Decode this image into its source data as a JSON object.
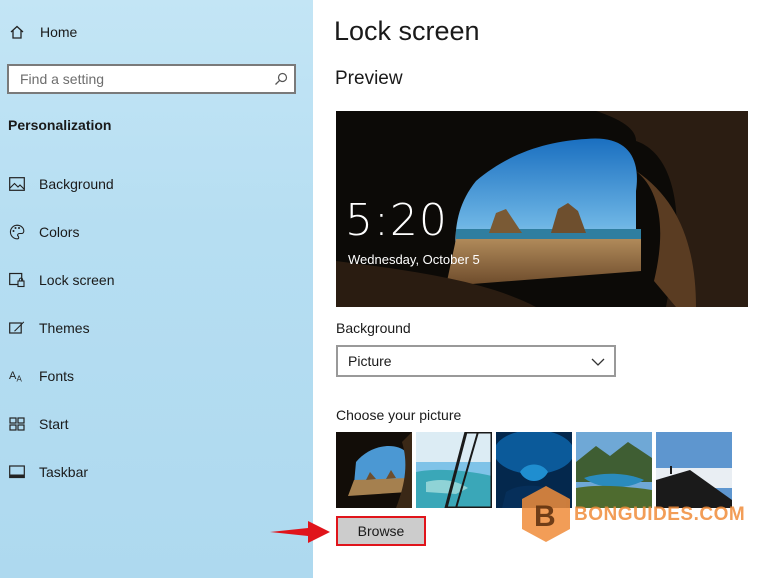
{
  "sidebar": {
    "home_label": "Home",
    "search_placeholder": "Find a setting",
    "section_title": "Personalization",
    "items": [
      {
        "label": "Background",
        "icon": "picture-icon"
      },
      {
        "label": "Colors",
        "icon": "palette-icon"
      },
      {
        "label": "Lock screen",
        "icon": "lock-screen-icon"
      },
      {
        "label": "Themes",
        "icon": "themes-icon"
      },
      {
        "label": "Fonts",
        "icon": "fonts-icon"
      },
      {
        "label": "Start",
        "icon": "start-icon"
      },
      {
        "label": "Taskbar",
        "icon": "taskbar-icon"
      }
    ]
  },
  "main": {
    "title": "Lock screen",
    "preview_heading": "Preview",
    "preview_time": "5:20",
    "preview_date": "Wednesday, October 5",
    "background_label": "Background",
    "background_value": "Picture",
    "choose_label": "Choose your picture",
    "browse_label": "Browse"
  },
  "watermark": {
    "text": "BONGUIDES.COM",
    "logo_letter": "B"
  },
  "colors": {
    "sidebar_bg": "#b6def2",
    "highlight_red": "#e0141b",
    "watermark_orange": "#f08c3a"
  }
}
